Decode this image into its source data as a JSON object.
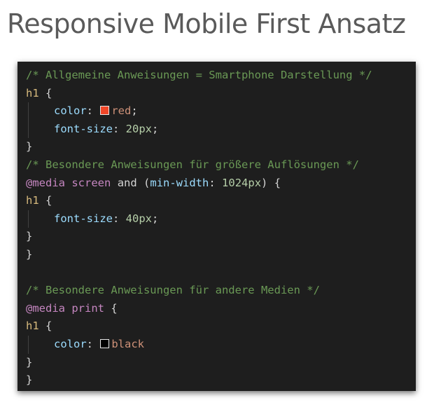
{
  "title": "Responsive Mobile First Ansatz",
  "colors": {
    "red_swatch": "#f04628",
    "black_swatch": "#000000"
  },
  "code": {
    "comment_1": "/* Allgemeine Anweisungen = Smartphone Darstellung */",
    "block1_selector": "h1",
    "block1_open": " {",
    "block1_prop1": "color",
    "block1_prop1_value": "red",
    "block1_prop2": "font-size",
    "block1_prop2_value": "20px",
    "block1_close": "}",
    "comment_2": "/* Besondere Anweisungen für größere Auflösungen */",
    "media1_keyword": "@media",
    "media1_type": "screen",
    "media1_and": "and",
    "media1_feature": "min-width",
    "media1_value": "1024px",
    "block2_selector": "h1",
    "block2_prop1": "font-size",
    "block2_prop1_value": "40px",
    "block2_close": "}",
    "media1_close": "}",
    "comment_3": "/* Besondere Anweisungen für andere Medien */",
    "media2_keyword": "@media",
    "media2_type": "print",
    "block3_selector": "h1",
    "block3_prop1": "color",
    "block3_prop1_value": "black",
    "block3_close": "}",
    "media2_close": "}"
  }
}
